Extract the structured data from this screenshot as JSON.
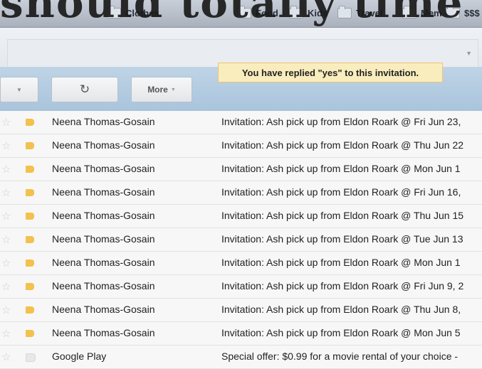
{
  "overlay": {
    "text": "should totally time"
  },
  "bookmarks": [
    "Clothes",
    "Food",
    "Kids",
    "Travel",
    "Mem",
    "$$$"
  ],
  "toolbar": {
    "refresh_icon": "refresh-icon",
    "more_label": "More",
    "notice": "You have replied \"yes\" to this invitation."
  },
  "messages": [
    {
      "sender": "Neena Thomas-Gosain",
      "subject": "Invitation: Ash pick up from Eldon Roark @ Fri Jun 23,"
    },
    {
      "sender": "Neena Thomas-Gosain",
      "subject": "Invitation: Ash pick up from Eldon Roark @ Thu Jun 22"
    },
    {
      "sender": "Neena Thomas-Gosain",
      "subject": "Invitation: Ash pick up from Eldon Roark @ Mon Jun 1"
    },
    {
      "sender": "Neena Thomas-Gosain",
      "subject": "Invitation: Ash pick up from Eldon Roark @ Fri Jun 16,"
    },
    {
      "sender": "Neena Thomas-Gosain",
      "subject": "Invitation: Ash pick up from Eldon Roark @ Thu Jun 15"
    },
    {
      "sender": "Neena Thomas-Gosain",
      "subject": "Invitation: Ash pick up from Eldon Roark @ Tue Jun 13"
    },
    {
      "sender": "Neena Thomas-Gosain",
      "subject": "Invitation: Ash pick up from Eldon Roark @ Mon Jun 1"
    },
    {
      "sender": "Neena Thomas-Gosain",
      "subject": "Invitation: Ash pick up from Eldon Roark @ Fri Jun 9, 2"
    },
    {
      "sender": "Neena Thomas-Gosain",
      "subject": "Invitation: Ash pick up from Eldon Roark @ Thu Jun 8,"
    },
    {
      "sender": "Neena Thomas-Gosain",
      "subject": "Invitation: Ash pick up from Eldon Roark @ Mon Jun 5"
    },
    {
      "sender": "Google Play",
      "subject": "Special offer: $0.99 for a movie rental of your choice -"
    }
  ]
}
